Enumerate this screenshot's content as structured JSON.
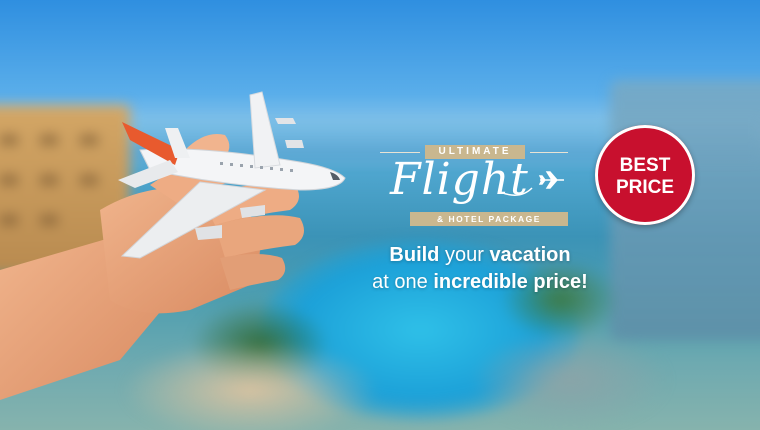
{
  "logo": {
    "top_label": "ULTIMATE",
    "script_word": "Flight",
    "bottom_label": "& HOTEL PACKAGE"
  },
  "headline": {
    "line1_bold": "Build",
    "line1_rest": " your ",
    "line1_bold2": "vacation",
    "line2_start": "at one ",
    "line2_bold": "incredible price!"
  },
  "badge": {
    "line1": "BEST",
    "line2": "PRICE"
  },
  "colors": {
    "badge_red": "#c8102e",
    "logo_gold": "#c9b78f",
    "plane_accent": "#e85a2e"
  }
}
